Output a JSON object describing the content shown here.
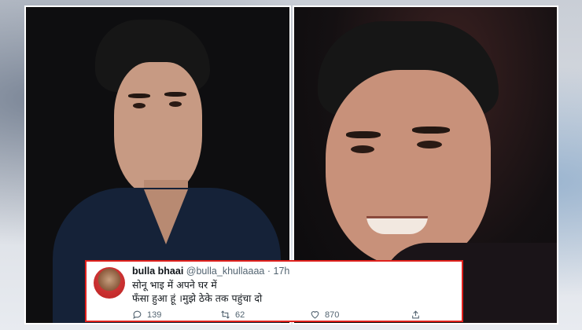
{
  "tweet": {
    "display_name": "bulla bhaai",
    "handle": "@bulla_khullaaaa",
    "separator": "·",
    "time": "17h",
    "text_line1": "सोनू भाइ में अपने घर में",
    "text_line2": "फँसा हुआ हूं ।मुझे ठेके तक पहुंचा दो",
    "replies": "139",
    "retweets": "62",
    "likes": "870"
  },
  "icons": {
    "reply": "reply-icon",
    "retweet": "retweet-icon",
    "like": "heart-icon",
    "share": "share-icon"
  },
  "colors": {
    "card_border": "#e0201c",
    "panel_border": "#ffffff"
  }
}
